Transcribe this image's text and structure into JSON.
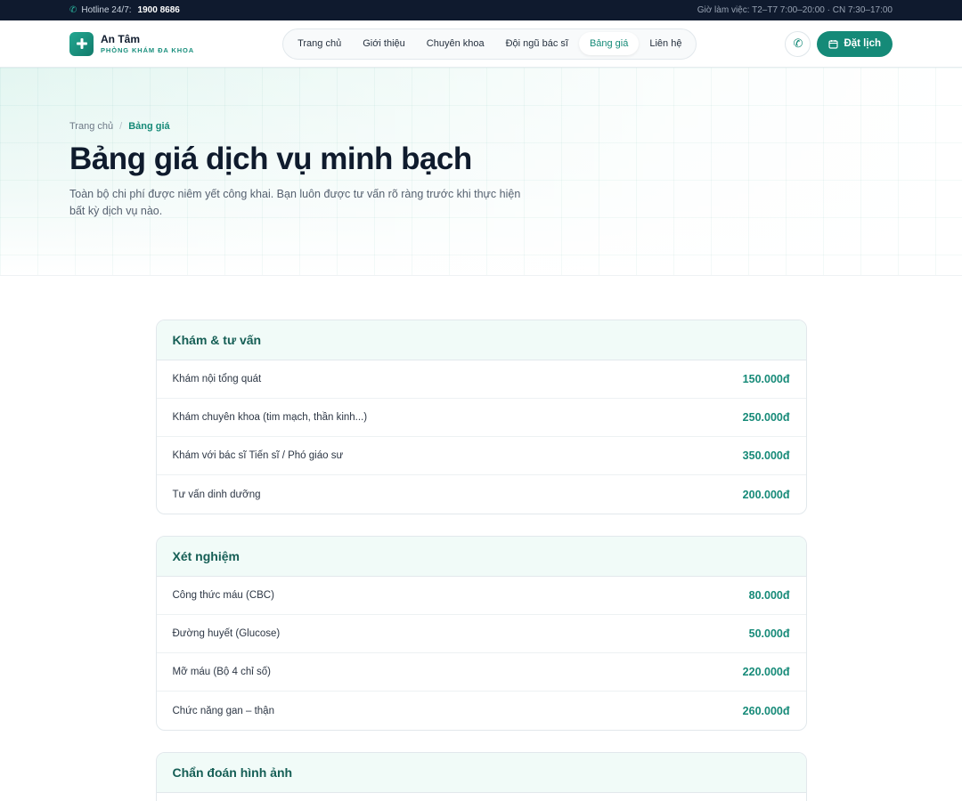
{
  "topbar": {
    "hotline_label": "Hotline 24/7:",
    "hotline_number": "1900 8686",
    "hours": "Giờ làm việc: T2–T7 7:00–20:00 · CN 7:30–17:00"
  },
  "brand": {
    "name": "An Tâm",
    "subtitle": "PHÒNG KHÁM ĐA KHOA"
  },
  "nav": {
    "items": [
      {
        "label": "Trang chủ"
      },
      {
        "label": "Giới thiệu"
      },
      {
        "label": "Chuyên khoa"
      },
      {
        "label": "Đội ngũ bác sĩ"
      },
      {
        "label": "Bảng giá"
      },
      {
        "label": "Liên hệ"
      }
    ],
    "active": "Bảng giá"
  },
  "actions": {
    "book_label": "Đặt lịch"
  },
  "breadcrumb": {
    "home": "Trang chủ",
    "separator": "/",
    "current": "Bảng giá"
  },
  "hero": {
    "title": "Bảng giá dịch vụ minh bạch",
    "description": "Toàn bộ chi phí được niêm yết công khai. Bạn luôn được tư vấn rõ ràng trước khi thực hiện bất kỳ dịch vụ nào."
  },
  "price_groups": [
    {
      "title": "Khám & tư vấn",
      "rows": [
        {
          "name": "Khám nội tổng quát",
          "price": "150.000đ"
        },
        {
          "name": "Khám chuyên khoa (tim mạch, thần kinh...)",
          "price": "250.000đ"
        },
        {
          "name": "Khám với bác sĩ Tiến sĩ / Phó giáo sư",
          "price": "350.000đ"
        },
        {
          "name": "Tư vấn dinh dưỡng",
          "price": "200.000đ"
        }
      ]
    },
    {
      "title": "Xét nghiệm",
      "rows": [
        {
          "name": "Công thức máu (CBC)",
          "price": "80.000đ"
        },
        {
          "name": "Đường huyết (Glucose)",
          "price": "50.000đ"
        },
        {
          "name": "Mỡ máu (Bộ 4 chỉ số)",
          "price": "220.000đ"
        },
        {
          "name": "Chức năng gan – thận",
          "price": "260.000đ"
        }
      ]
    },
    {
      "title": "Chẩn đoán hình ảnh",
      "rows": []
    }
  ],
  "colors": {
    "accent": "#158a78",
    "topbar_bg": "#0f1a2e",
    "text": "#0f1b2d"
  },
  "icons": {
    "hotline": "phone-icon",
    "logo": "medical-cross-icon",
    "call_button": "phone-icon",
    "book_button": "calendar-icon"
  }
}
